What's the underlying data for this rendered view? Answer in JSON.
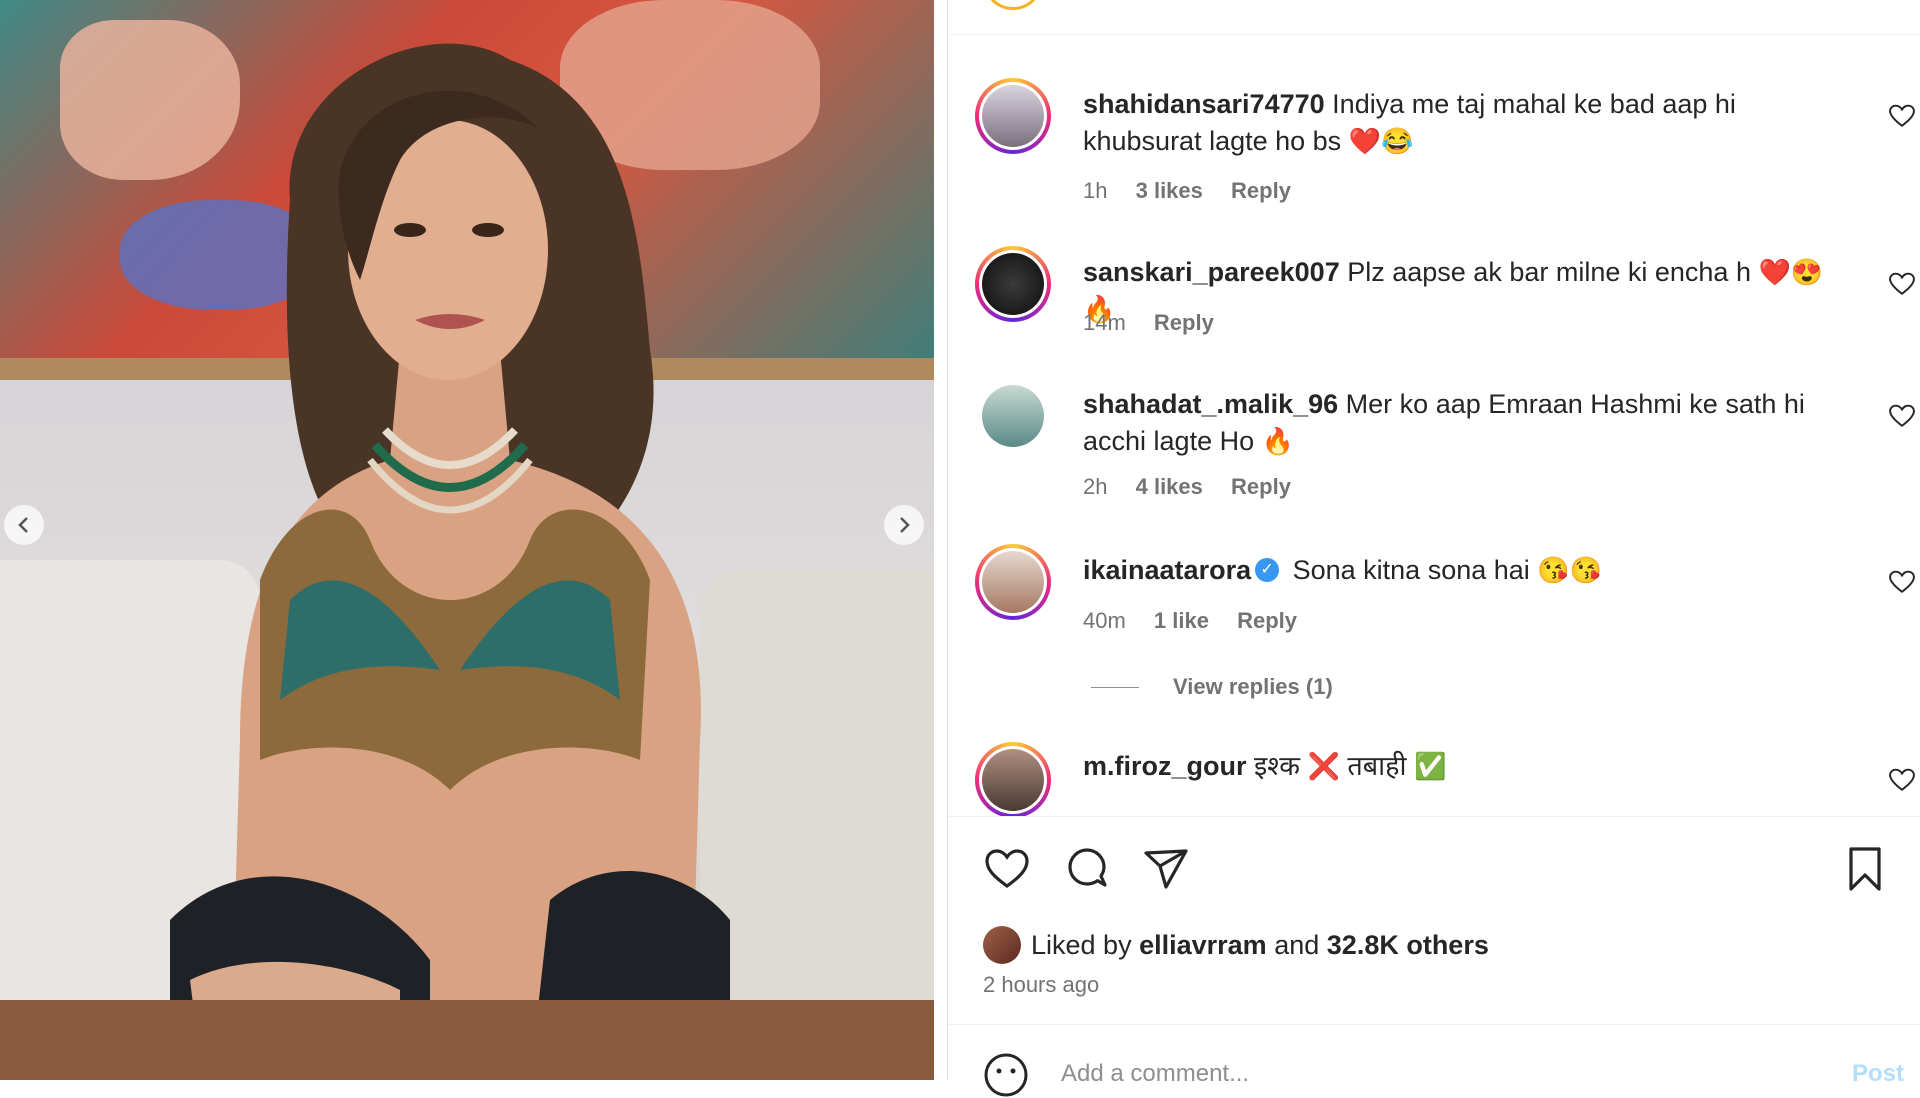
{
  "photo": {
    "prev_icon": "chevron-left-icon",
    "next_icon": "chevron-right-icon"
  },
  "comments": [
    {
      "username": "shahidansari74770",
      "text": "Indiya me taj mahal ke bad aap hi khubsurat lagte ho bs",
      "emojis": "❤️😂",
      "time": "1h",
      "likes": "3 likes",
      "reply": "Reply",
      "verified": false
    },
    {
      "username": "sanskari_pareek007",
      "text": "Plz aapse ak bar milne ki encha h",
      "emojis": "❤️😍🔥",
      "time": "14m",
      "likes": "",
      "reply": "Reply",
      "verified": false
    },
    {
      "username": "shahadat_.malik_96",
      "text": "Mer ko aap Emraan Hashmi ke sath hi acchi lagte Ho",
      "emojis": "🔥",
      "time": "2h",
      "likes": "4 likes",
      "reply": "Reply",
      "verified": false
    },
    {
      "username": "ikainaatarora",
      "text": "Sona kitna sona hai",
      "emojis": "😘😘",
      "time": "40m",
      "likes": "1 like",
      "reply": "Reply",
      "verified": true
    },
    {
      "username": "m.firoz_gour",
      "text": "इश्क",
      "emojis": "❌",
      "text2": "तबाही",
      "emojis2": "✅",
      "verified": false
    }
  ],
  "view_replies": "View replies (1)",
  "actions": {
    "like_icon": "heart-icon",
    "comment_icon": "comment-icon",
    "share_icon": "send-icon",
    "save_icon": "bookmark-icon"
  },
  "likes": {
    "prefix": "Liked by",
    "user": "elliavrram",
    "and": "and",
    "others": "32.8K others"
  },
  "posted": "2 hours ago",
  "comment_box": {
    "placeholder": "Add a comment...",
    "post_label": "Post"
  }
}
